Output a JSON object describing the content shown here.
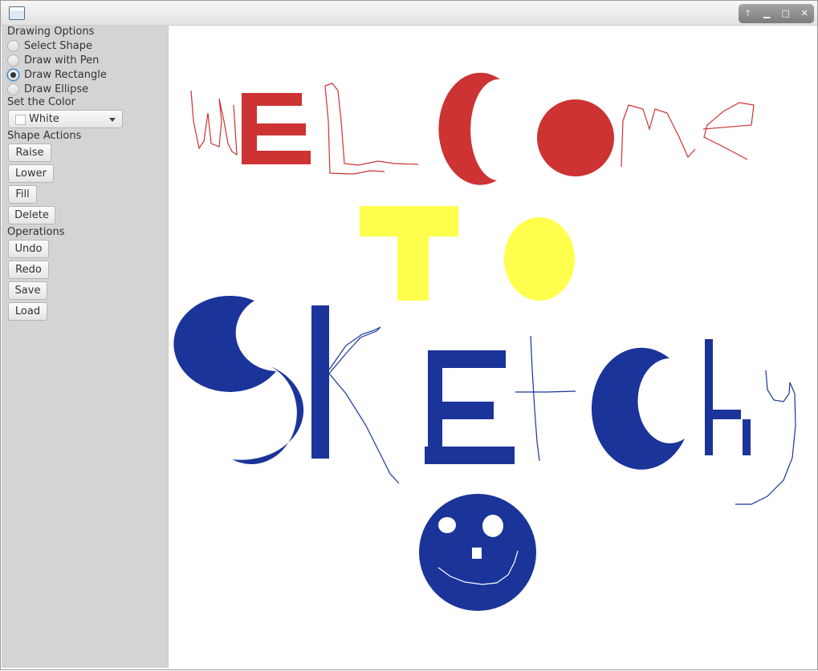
{
  "sidebar": {
    "drawing_options_label": "Drawing Options",
    "tools": [
      {
        "label": "Select Shape",
        "selected": false
      },
      {
        "label": "Draw with Pen",
        "selected": false
      },
      {
        "label": "Draw Rectangle",
        "selected": true
      },
      {
        "label": "Draw Ellipse",
        "selected": false
      }
    ],
    "color_label": "Set the Color",
    "color_select": {
      "value": "White",
      "swatch": "#ffffff"
    },
    "shape_actions_label": "Shape Actions",
    "shape_actions": [
      "Raise",
      "Lower",
      "Fill",
      "Delete"
    ],
    "operations_label": "Operations",
    "operations": [
      "Undo",
      "Redo",
      "Save",
      "Load"
    ]
  },
  "window_controls": {
    "up": "🡑",
    "minimize": "▁",
    "maximize": "□",
    "close": "✕"
  },
  "canvas": {
    "colors": {
      "red": "#cd3333",
      "yellow": "#ffff4d",
      "blue": "#1a3499",
      "white": "#ffffff",
      "pen_red": "#cd3333",
      "pen_blue": "#1a3499"
    }
  }
}
